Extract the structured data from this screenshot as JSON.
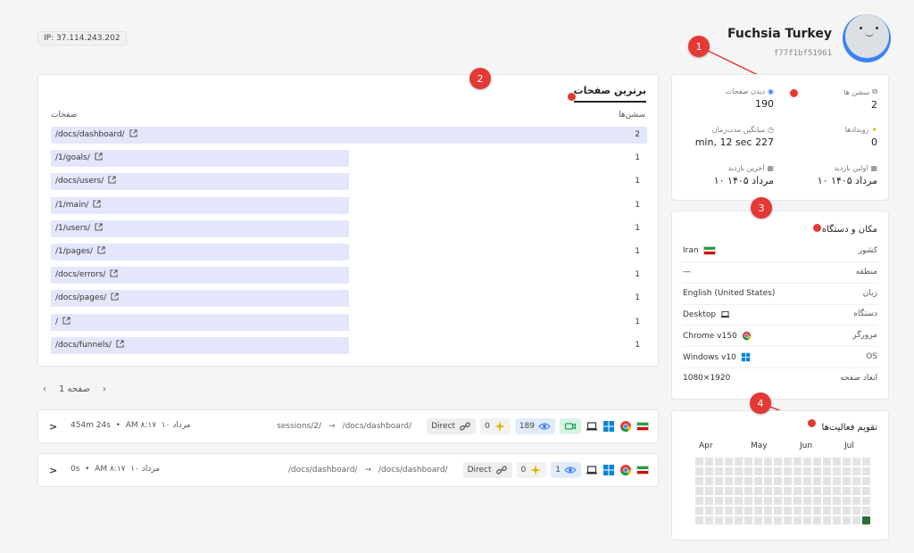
{
  "ip_badge": "IP: 37.114.243.202",
  "profile": {
    "name": "Fuchsia Turkey",
    "id": "f77f1bf51961"
  },
  "top_pages": {
    "title": "برترین صفحات",
    "col_sessions": "سشن‌ها",
    "col_pages": "صفحات",
    "rows": [
      {
        "path": "/docs/dashboard/",
        "count": 2,
        "share": 1.0
      },
      {
        "path": "/1/goals/",
        "count": 1,
        "share": 0.5
      },
      {
        "path": "/docs/users/",
        "count": 1,
        "share": 0.5
      },
      {
        "path": "/1/main/",
        "count": 1,
        "share": 0.5
      },
      {
        "path": "/1/users/",
        "count": 1,
        "share": 0.5
      },
      {
        "path": "/1/pages/",
        "count": 1,
        "share": 0.5
      },
      {
        "path": "/docs/errors/",
        "count": 1,
        "share": 0.5
      },
      {
        "path": "/docs/pages/",
        "count": 1,
        "share": 0.5
      },
      {
        "path": "/",
        "count": 1,
        "share": 0.5
      },
      {
        "path": "/docs/funnels/",
        "count": 1,
        "share": 0.5
      }
    ]
  },
  "pager": {
    "label": "صفحه 1",
    "prev": "‹",
    "next": "›"
  },
  "sessions": [
    {
      "duration": "454m 24s",
      "time": "AM ۸:۱۷",
      "date": "۱۰ مرداد",
      "path_from": "sessions/2/",
      "path_to": "/docs/dashboard/",
      "source": "Direct",
      "events": "0",
      "views": "189",
      "has_recording": true
    },
    {
      "duration": "0s",
      "time": "AM ۸:۱۷",
      "date": "۱۰ مرداد",
      "path_from": "/docs/dashboard/",
      "path_to": "/docs/dashboard/",
      "source": "Direct",
      "events": "0",
      "views": "1",
      "has_recording": false
    }
  ],
  "stats": {
    "sessions_label": "سشن ها",
    "sessions_value": "2",
    "pageviews_label": "دیدن صفحات",
    "pageviews_value": "190",
    "events_label": "رویدادها",
    "events_value": "0",
    "avg_duration_label": "میانگین مدت‌زمان",
    "avg_duration_value": "min, 12 sec 227",
    "first_visit_label": "اولین بازدید",
    "first_visit_value": "۱۰ مرداد ۱۴۰۵",
    "last_visit_label": "آخرین بازدید",
    "last_visit_value": "۱۰ مرداد ۱۴۰۵"
  },
  "geo": {
    "title": "مکان و دستگاه",
    "rows": [
      {
        "key": "کشور",
        "value": "Iran"
      },
      {
        "key": "منطقه",
        "value": "—"
      },
      {
        "key": "زبان",
        "value": "English (United States)"
      },
      {
        "key": "دستگاه",
        "value": "Desktop"
      },
      {
        "key": "مرورگر",
        "value": "Chrome v150"
      },
      {
        "key": "OS",
        "value": "Windows v10"
      },
      {
        "key": "ابعاد صفحه",
        "value": "1080×1920"
      }
    ]
  },
  "calendar": {
    "title": "تقویم فعالیت‌ها",
    "months": [
      "Apr",
      "May",
      "Jun",
      "Jul"
    ]
  },
  "markers": [
    "1",
    "2",
    "3",
    "4"
  ],
  "colors": {
    "accent": "#e53935",
    "bar": "#e4e7fb",
    "active_day": "#2e6b35"
  }
}
